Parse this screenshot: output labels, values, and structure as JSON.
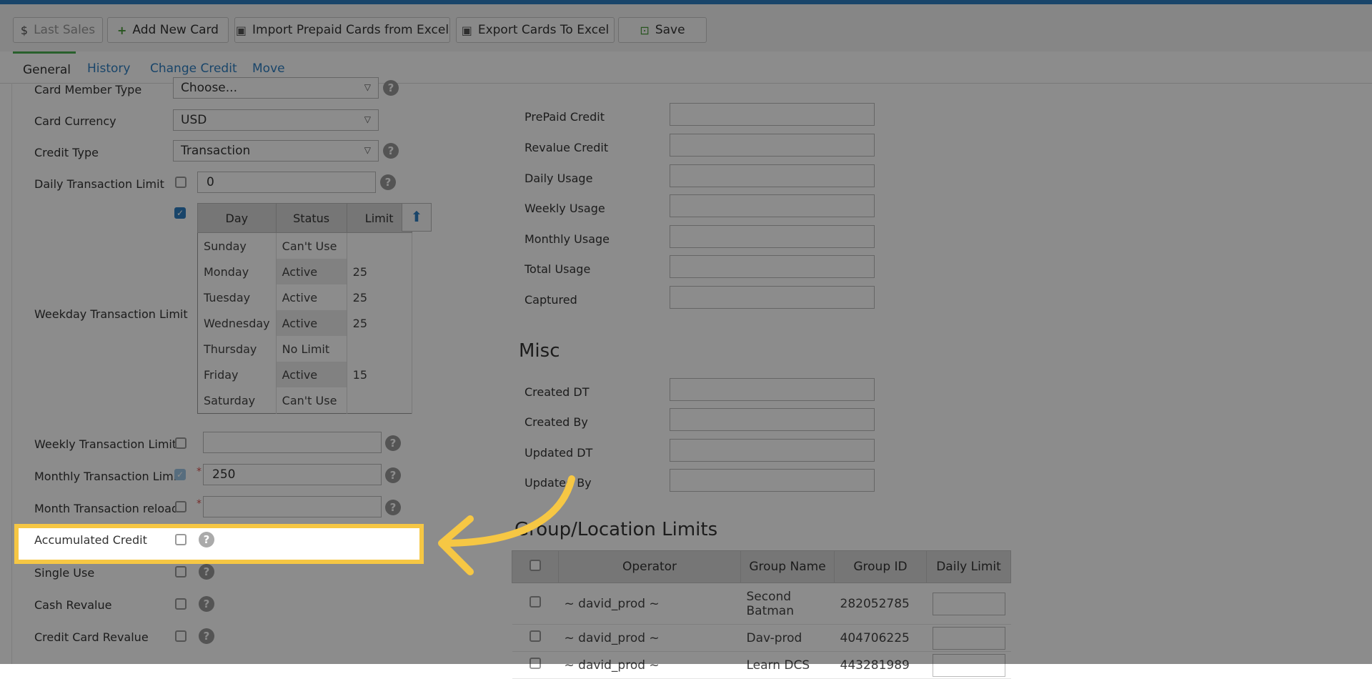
{
  "toolbar": {
    "last_sales": "Last Sales",
    "add_new_card": "Add New Card",
    "import_prepaid": "Import Prepaid Cards from Excel",
    "export_cards": "Export Cards To Excel",
    "save": "Save"
  },
  "tabs": [
    "General",
    "History",
    "Change Credit",
    "Move"
  ],
  "form": {
    "card_member_type": {
      "label": "Card Member Type",
      "value": "Choose..."
    },
    "card_currency": {
      "label": "Card Currency",
      "value": "USD"
    },
    "credit_type": {
      "label": "Credit Type",
      "value": "Transaction"
    },
    "daily_transaction_limit": {
      "label": "Daily Transaction Limit",
      "value": "0"
    },
    "weekday_transaction_limit": {
      "label": "Weekday Transaction Limit"
    },
    "weekly_transaction_limit": {
      "label": "Weekly Transaction Limit",
      "value": ""
    },
    "monthly_transaction_limit": {
      "label": "Monthly Transaction Limit",
      "value": "250"
    },
    "month_transaction_reload": {
      "label": "Month Transaction reload",
      "value": ""
    },
    "accumulated_credit": {
      "label": "Accumulated Credit"
    },
    "single_use": {
      "label": "Single Use"
    },
    "cash_revalue": {
      "label": "Cash Revalue"
    },
    "credit_card_revalue": {
      "label": "Credit Card Revalue"
    }
  },
  "weekday_table": {
    "headers": [
      "Day",
      "Status",
      "Limit"
    ],
    "rows": [
      {
        "day": "Sunday",
        "status": "Can't Use",
        "limit": ""
      },
      {
        "day": "Monday",
        "status": "Active",
        "limit": "25"
      },
      {
        "day": "Tuesday",
        "status": "Active",
        "limit": "25"
      },
      {
        "day": "Wednesday",
        "status": "Active",
        "limit": "25"
      },
      {
        "day": "Thursday",
        "status": "No Limit",
        "limit": ""
      },
      {
        "day": "Friday",
        "status": "Active",
        "limit": "15"
      },
      {
        "day": "Saturday",
        "status": "Can't Use",
        "limit": ""
      }
    ]
  },
  "usage": {
    "prepaid_credit": "PrePaid Credit",
    "revalue_credit": "Revalue Credit",
    "daily_usage": "Daily Usage",
    "weekly_usage": "Weekly Usage",
    "monthly_usage": "Monthly Usage",
    "total_usage": "Total Usage",
    "captured": "Captured"
  },
  "misc": {
    "title": "Misc",
    "created_dt": "Created DT",
    "created_by": "Created By",
    "updated_dt": "Updated DT",
    "updated_by": "Updated By"
  },
  "group_limits": {
    "title": "Group/Location Limits",
    "headers": [
      "Operator",
      "Group Name",
      "Group ID",
      "Daily Limit"
    ],
    "rows": [
      {
        "operator": "~ david_prod ~",
        "group_name": "Second Batman",
        "group_id": "282052785"
      },
      {
        "operator": "~ david_prod ~",
        "group_name": "Dav-prod",
        "group_id": "404706225"
      },
      {
        "operator": "~ david_prod ~",
        "group_name": "Learn DCS",
        "group_id": "443281989"
      }
    ]
  },
  "icons": {
    "dollar": "dollar-icon",
    "plus": "plus-icon",
    "excel": "excel-icon",
    "save": "save-icon",
    "help": "help-icon",
    "upload": "upload-icon",
    "arrow": "curved-arrow-icon"
  },
  "colors": {
    "accent": "#2f7fc1",
    "highlight": "#f6c744",
    "tab_active": "#4caf50"
  }
}
